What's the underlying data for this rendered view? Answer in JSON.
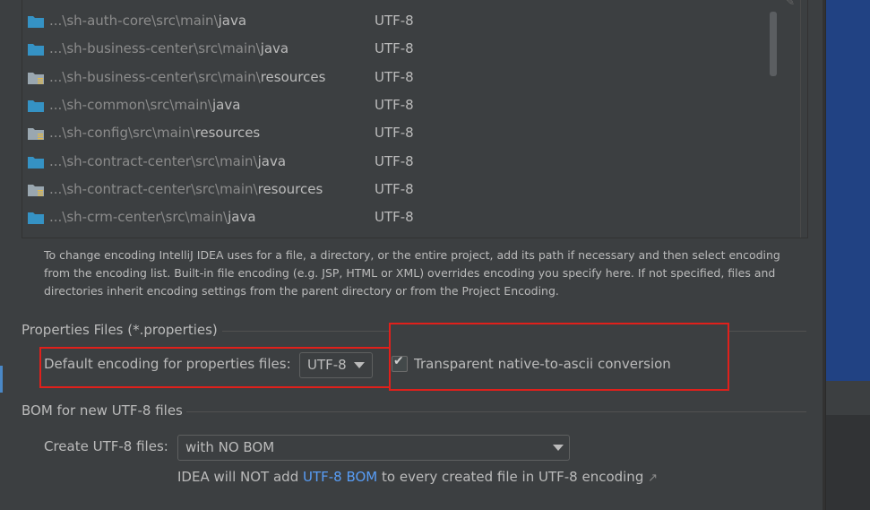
{
  "path_table": {
    "rows": [
      {
        "prefix": "...\\sh-auth-core\\src\\main\\",
        "leaf": "java",
        "encoding": "UTF-8",
        "type": "source"
      },
      {
        "prefix": "...\\sh-business-center\\src\\main\\",
        "leaf": "java",
        "encoding": "UTF-8",
        "type": "source"
      },
      {
        "prefix": "...\\sh-business-center\\src\\main\\",
        "leaf": "resources",
        "encoding": "UTF-8",
        "type": "resources"
      },
      {
        "prefix": "...\\sh-common\\src\\main\\",
        "leaf": "java",
        "encoding": "UTF-8",
        "type": "source"
      },
      {
        "prefix": "...\\sh-config\\src\\main\\",
        "leaf": "resources",
        "encoding": "UTF-8",
        "type": "resources"
      },
      {
        "prefix": "...\\sh-contract-center\\src\\main\\",
        "leaf": "java",
        "encoding": "UTF-8",
        "type": "source"
      },
      {
        "prefix": "...\\sh-contract-center\\src\\main\\",
        "leaf": "resources",
        "encoding": "UTF-8",
        "type": "resources"
      },
      {
        "prefix": "...\\sh-crm-center\\src\\main\\",
        "leaf": "java",
        "encoding": "UTF-8",
        "type": "source"
      }
    ]
  },
  "info_text": "To change encoding IntelliJ IDEA uses for a file, a directory, or the entire project, add its path if necessary and then select encoding from the encoding list. Built-in file encoding (e.g. JSP, HTML or XML) overrides encoding you specify here. If not specified, files and directories inherit encoding settings from the parent directory or from the Project Encoding.",
  "properties_section": {
    "title": "Properties Files (*.properties)",
    "default_encoding_label": "Default encoding for properties files:",
    "default_encoding_value": "UTF-8",
    "native_ascii_label": "Transparent native-to-ascii conversion",
    "native_ascii_checked": true
  },
  "bom_section": {
    "title": "BOM for new UTF-8 files",
    "create_label": "Create UTF-8 files:",
    "create_value": "with NO BOM",
    "hint_before": "IDEA will NOT add ",
    "hint_link": "UTF-8 BOM",
    "hint_after": " to every created file in UTF-8 encoding",
    "hint_ext": "↗"
  },
  "colors": {
    "background": "#3c3f41",
    "text": "#bbbbbb",
    "link": "#589df6",
    "highlight_red": "#e0201b",
    "folder_blue": "#3592c4",
    "folder_gray": "#9aa7b0"
  }
}
